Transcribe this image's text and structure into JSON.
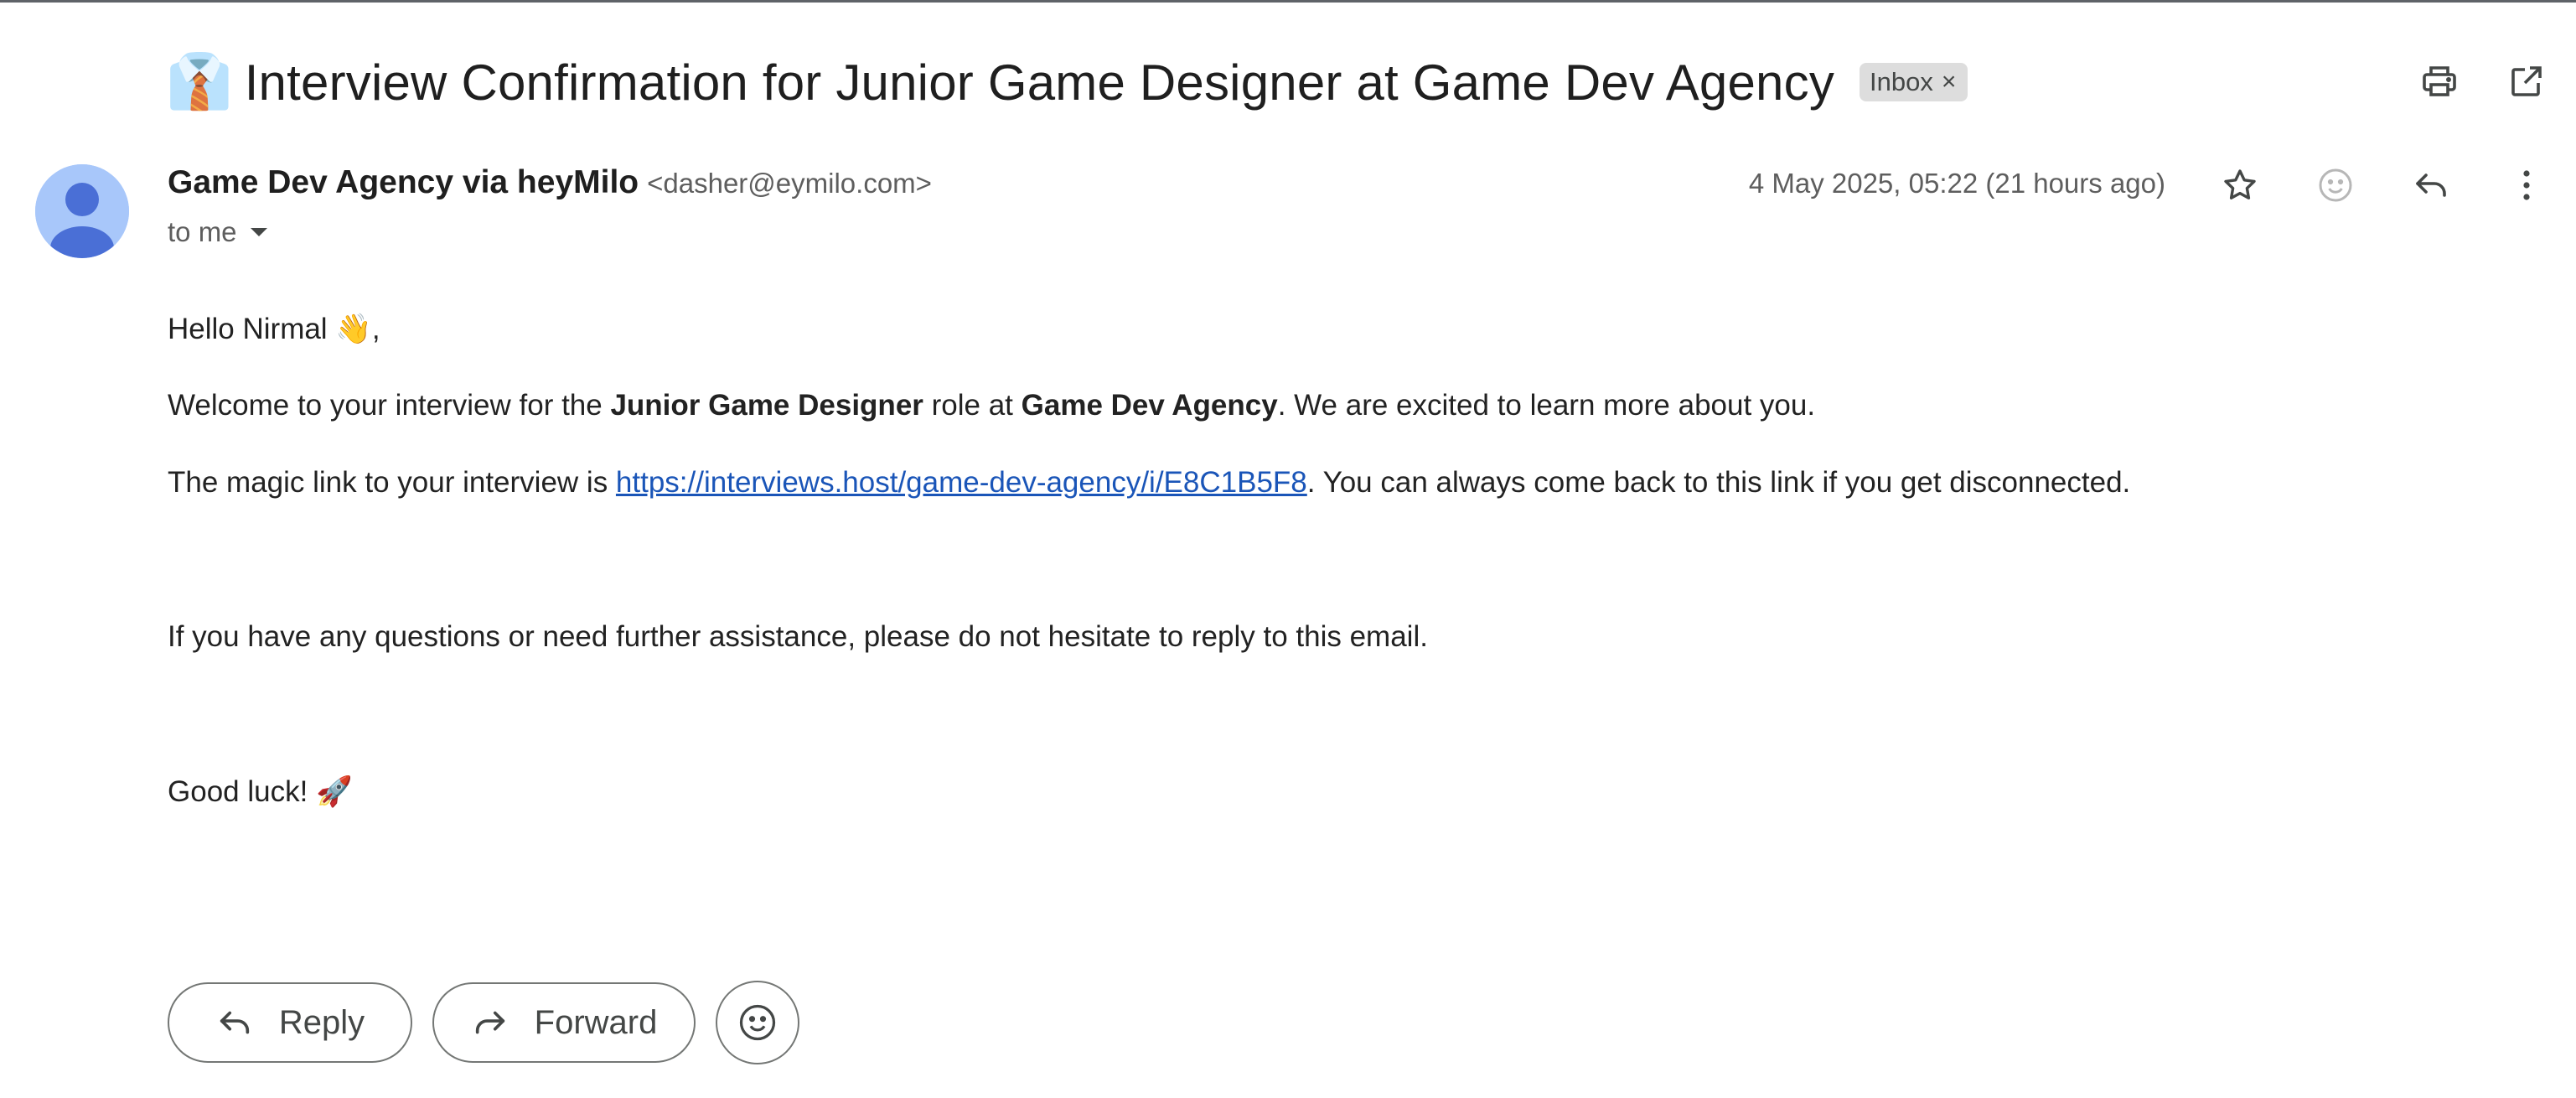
{
  "email": {
    "subject_emoji": "👔",
    "subject": "Interview Confirmation for Junior Game Designer at Game Dev Agency",
    "label": "Inbox",
    "label_remove": "×",
    "sender_name": "Game Dev Agency via heyMilo",
    "sender_email": "<dasher@eymilo.com>",
    "to_label": "to me",
    "date": "4 May 2025, 05:22 (21 hours ago)"
  },
  "body": {
    "greeting": "Hello Nirmal",
    "greeting_emoji": "👋",
    "greeting_end": ",",
    "p1_a": "Welcome to your interview for the ",
    "p1_role": "Junior Game Designer",
    "p1_b": " role at ",
    "p1_company": "Game Dev Agency",
    "p1_c": ". We are excited to learn more about you.",
    "p2_a": "The magic link to your interview is ",
    "p2_link": "https://interviews.host/game-dev-agency/i/E8C1B5F8",
    "p2_b": ". You can always come back to this link if you get disconnected.",
    "p3": "If you have any questions or need further assistance, please do not hesitate to reply to this email.",
    "p4": "Good luck! ",
    "p4_emoji": "🚀"
  },
  "actions": {
    "reply_label": "Reply",
    "forward_label": "Forward"
  },
  "icons": {
    "print": "print-icon",
    "open_new": "open-in-new-window-icon",
    "star": "star-icon",
    "emoji": "emoji-reaction-icon",
    "reply": "reply-icon",
    "more": "more-vertical-icon",
    "forward": "forward-icon"
  },
  "colors": {
    "avatar_bg": "#a8c7fa",
    "avatar_fg": "#4a6fd6",
    "link": "#1a55b8",
    "chip_bg": "#dddddd"
  }
}
